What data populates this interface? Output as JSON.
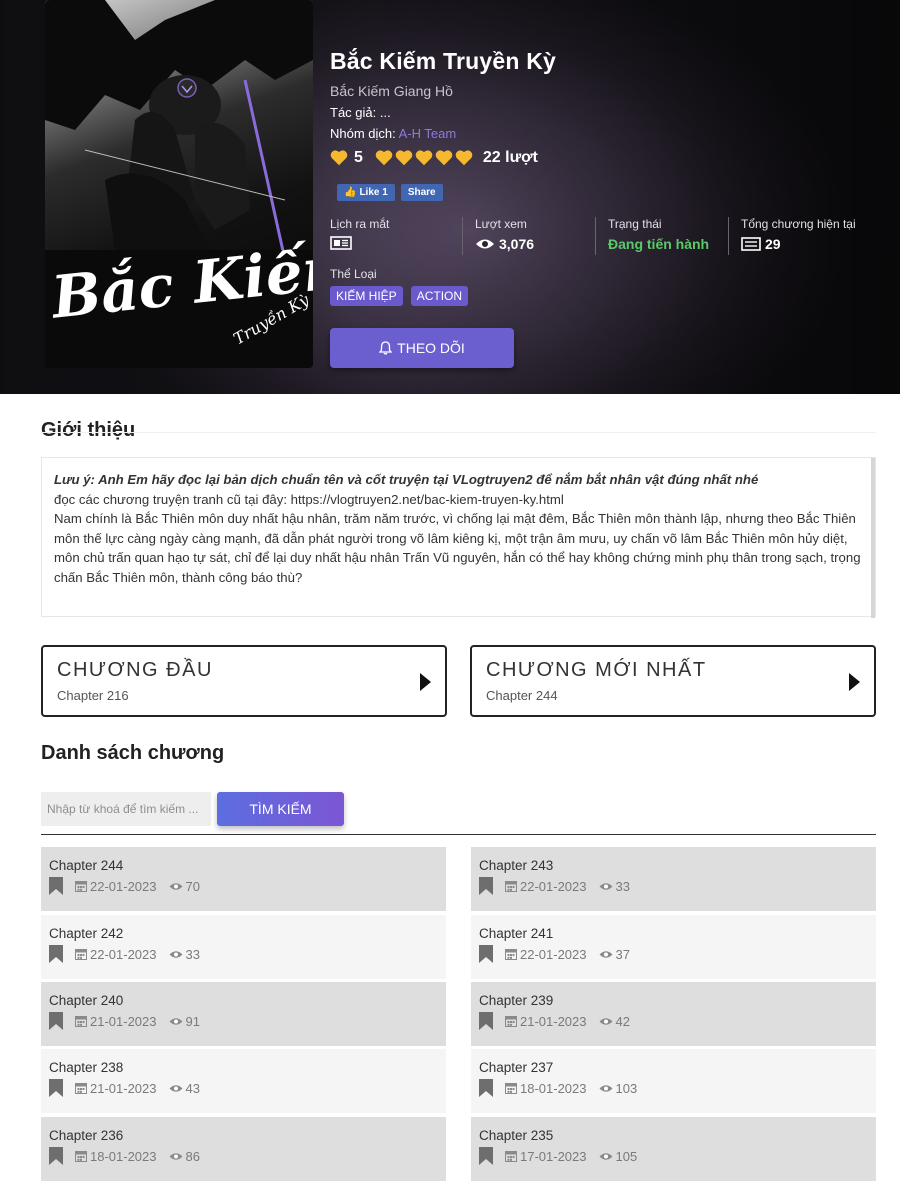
{
  "manga": {
    "title": "Bắc Kiếm Truyền Kỳ",
    "alt_title": "Bắc Kiếm Giang Hồ",
    "author_label": "Tác giả: ...",
    "group_label": "Nhóm dịch:",
    "group_name": "A-H Team",
    "cover_text_main": "Bắc Kiếm",
    "cover_text_sub": "Truyền Kỳ"
  },
  "rating": {
    "score": "5",
    "hearts": 5,
    "votes": "22 lượt",
    "heart_color": "#f5b82e"
  },
  "facebook": {
    "like_label": "Like 1",
    "share_label": "Share"
  },
  "stats": {
    "release_label": "Lịch ra mắt",
    "views_label": "Lượt xem",
    "views_value": "3,076",
    "status_label": "Trạng thái",
    "status_value": "Đang tiến hành",
    "total_label": "Tổng chương hiện tại",
    "total_value": "29"
  },
  "genres": {
    "label": "Thể Loại",
    "items": [
      "KIẾM HIỆP",
      "ACTION"
    ]
  },
  "follow_label": "THEO DÕI",
  "intro": {
    "heading": "Giới thiệu",
    "note": "Lưu ý: Anh Em hãy đọc lại bản dịch chuẩn tên và cốt truyện tại VLogtruyen2 để nắm bắt nhân vật đúng nhất nhé",
    "old_link": "đọc các chương truyện tranh cũ tại đây: https://vlogtruyen2.net/bac-kiem-truyen-ky.html",
    "body": "Nam chính là Bắc Thiên môn duy nhất hậu nhân, trăm năm trước, vì chống lại mật đêm, Bắc Thiên môn thành lập, nhưng theo Bắc Thiên môn thế lực càng ngày càng mạnh, đã dẫn phát người trong võ lâm kiêng kị, một trận âm mưu, uy chấn võ lâm Bắc Thiên môn hủy diệt, môn chủ trấn quan hạo tự sát, chỉ để lại duy nhất hậu nhân Trấn Vũ nguyên, hắn có thể hay không chứng minh phụ thân trong sạch, trọng chấn Bắc Thiên môn, thành công báo thù?"
  },
  "first_chapter": {
    "label": "CHƯƠNG ĐẦU",
    "chapter": "Chapter 216"
  },
  "latest_chapter": {
    "label": "CHƯƠNG MỚI NHẤT",
    "chapter": "Chapter 244"
  },
  "chapter_list": {
    "heading": "Danh sách chương",
    "search_placeholder": "Nhập từ khoá để tìm kiếm ...",
    "search_button": "TÌM KIẾM",
    "items": [
      {
        "name": "Chapter 244",
        "date": "22-01-2023",
        "views": "70"
      },
      {
        "name": "Chapter 243",
        "date": "22-01-2023",
        "views": "33"
      },
      {
        "name": "Chapter 242",
        "date": "22-01-2023",
        "views": "33"
      },
      {
        "name": "Chapter 241",
        "date": "22-01-2023",
        "views": "37"
      },
      {
        "name": "Chapter 240",
        "date": "21-01-2023",
        "views": "91"
      },
      {
        "name": "Chapter 239",
        "date": "21-01-2023",
        "views": "42"
      },
      {
        "name": "Chapter 238",
        "date": "21-01-2023",
        "views": "43"
      },
      {
        "name": "Chapter 237",
        "date": "18-01-2023",
        "views": "103"
      },
      {
        "name": "Chapter 236",
        "date": "18-01-2023",
        "views": "86"
      },
      {
        "name": "Chapter 235",
        "date": "17-01-2023",
        "views": "105"
      }
    ]
  }
}
